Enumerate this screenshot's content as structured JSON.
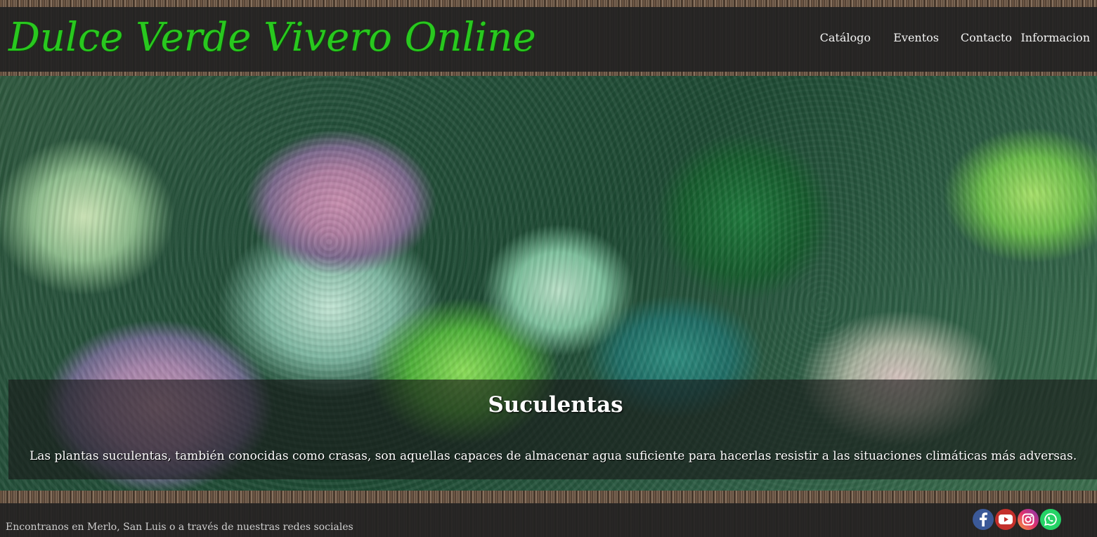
{
  "header": {
    "logo_text": "Dulce Verde Vivero Online",
    "nav": [
      {
        "label": "Catálogo"
      },
      {
        "label": "Eventos"
      },
      {
        "label": "Contacto"
      },
      {
        "label": "Informacion"
      }
    ]
  },
  "hero": {
    "title": "Suculentas",
    "description": "Las plantas suculentas, también conocidas como crasas, son aquellas capaces de almacenar agua suficiente para hacerlas resistir a las situaciones climáticas más adversas."
  },
  "footer": {
    "text": "Encontranos en Merlo, San Luis o a través de nuestras redes sociales",
    "social": [
      {
        "icon": "facebook-icon",
        "color": "#3b5998"
      },
      {
        "icon": "youtube-icon",
        "color": "#c4302b"
      },
      {
        "icon": "instagram-icon",
        "color": "#c13584"
      },
      {
        "icon": "whatsapp-icon",
        "color": "#25d366"
      }
    ]
  },
  "colors": {
    "logo": "#29c81f",
    "bar": "#222222"
  }
}
